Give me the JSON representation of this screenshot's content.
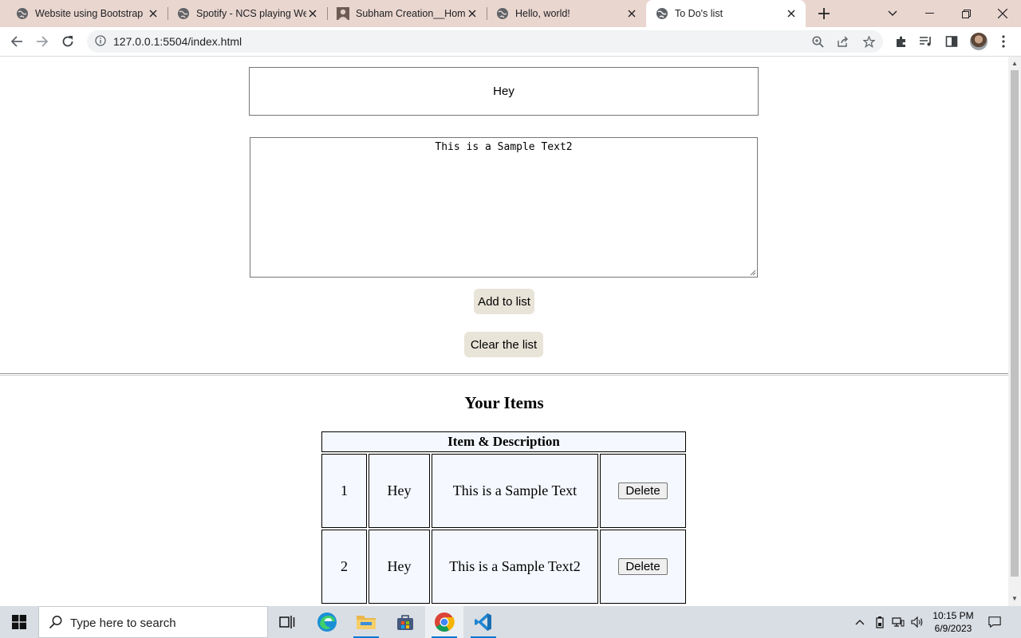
{
  "browser": {
    "tabs": [
      {
        "title": "Website using Bootstrap",
        "active": false,
        "icon": "globe-icon"
      },
      {
        "title": "Spotify - NCS playing Wel",
        "active": false,
        "icon": "globe-icon"
      },
      {
        "title": "Subham Creation__Home",
        "active": false,
        "icon": "profile-photo-icon"
      },
      {
        "title": "Hello, world!",
        "active": false,
        "icon": "globe-icon"
      },
      {
        "title": "To Do's list",
        "active": true,
        "icon": "globe-icon"
      }
    ],
    "url": "127.0.0.1:5504/index.html"
  },
  "form": {
    "title_value": "Hey",
    "description_value": "This is a Sample Text2",
    "add_label": "Add to list",
    "clear_label": "Clear the list"
  },
  "items": {
    "heading": "Your Items",
    "table_header": "Item & Description",
    "delete_label": "Delete",
    "rows": [
      {
        "num": "1",
        "title": "Hey",
        "desc": "This is a Sample Text"
      },
      {
        "num": "2",
        "title": "Hey",
        "desc": "This is a Sample Text2"
      }
    ]
  },
  "taskbar": {
    "search_placeholder": "Type here to search",
    "time": "10:15 PM",
    "date": "6/9/2023"
  },
  "colors": {
    "tabbar": "#e9d6cf",
    "button_bg": "#e9e4d8",
    "table_cell_bg": "#f5f8ff"
  }
}
